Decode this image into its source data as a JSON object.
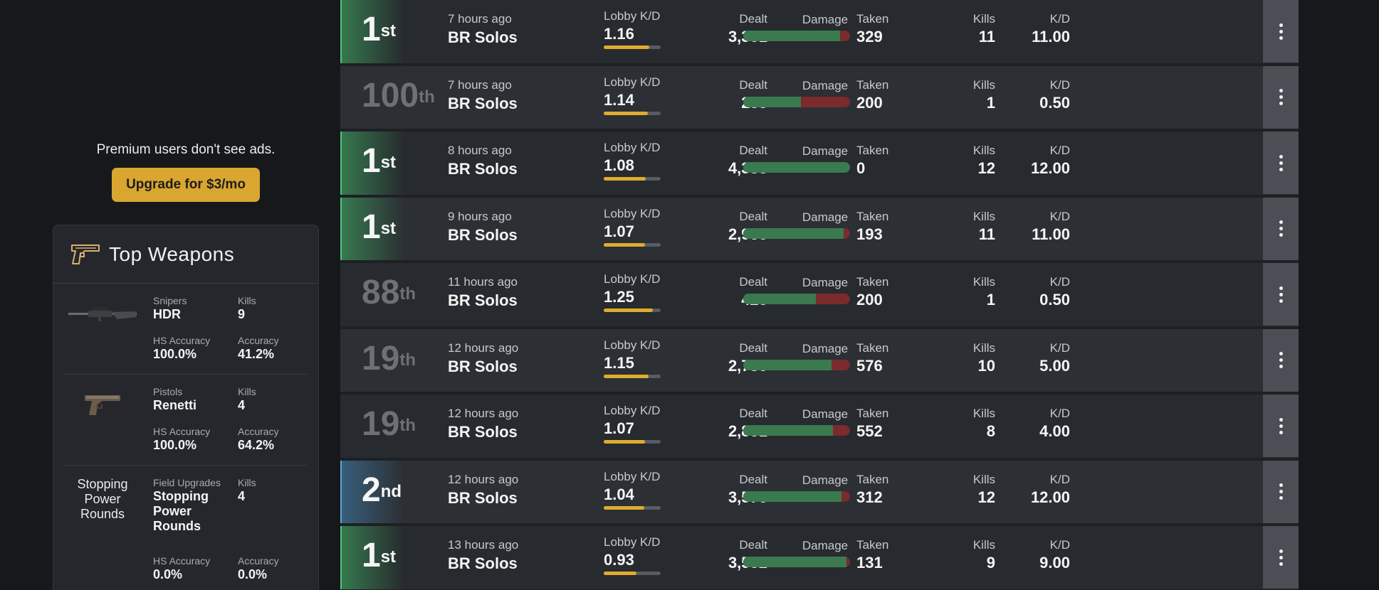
{
  "promo": {
    "text": "Premium users don't see ads.",
    "button_label": "Upgrade for $3/mo"
  },
  "weapons": {
    "title": "Top Weapons",
    "items": [
      {
        "category": "Snipers",
        "name": "HDR",
        "kills_label": "Kills",
        "kills": "9",
        "hs_label": "HS Accuracy",
        "hs": "100.0%",
        "acc_label": "Accuracy",
        "acc": "41.2%",
        "image": "sniper-rifle"
      },
      {
        "category": "Pistols",
        "name": "Renetti",
        "kills_label": "Kills",
        "kills": "4",
        "hs_label": "HS Accuracy",
        "hs": "100.0%",
        "acc_label": "Accuracy",
        "acc": "64.2%",
        "image": "pistol"
      },
      {
        "category": "Field Upgrades",
        "name": "Stopping Power Rounds",
        "image_text": "Stopping Power Rounds",
        "kills_label": "Kills",
        "kills": "4",
        "hs_label": "HS Accuracy",
        "hs": "0.0%",
        "acc_label": "Accuracy",
        "acc": "0.0%"
      }
    ]
  },
  "labels": {
    "lobby": "Lobby K/D",
    "dealt": "Dealt",
    "damage": "Damage",
    "taken": "Taken",
    "kills": "Kills",
    "kd": "K/D"
  },
  "colors": {
    "win_accent": "#52c37a",
    "second_accent": "#5fa7d8",
    "lobby_bar": "#e0ac2e",
    "damage_dealt": "#3a7a4e",
    "damage_taken": "#7b2a2d",
    "promo_button": "#d9a630"
  },
  "matches": [
    {
      "place": "1",
      "suffix": "st",
      "status": "win",
      "time": "7 hours ago",
      "mode": "BR Solos",
      "lobby_kd": "1.16",
      "lobby_pct": 0.8,
      "dealt": "3,301",
      "taken": "329",
      "kills": "11",
      "kd": "11.00",
      "dealt_share": 0.909
    },
    {
      "place": "100",
      "suffix": "th",
      "status": "lose",
      "time": "7 hours ago",
      "mode": "BR Solos",
      "lobby_kd": "1.14",
      "lobby_pct": 0.78,
      "dealt": "233",
      "taken": "200",
      "kills": "1",
      "kd": "0.50",
      "dealt_share": 0.538
    },
    {
      "place": "1",
      "suffix": "st",
      "status": "win",
      "time": "8 hours ago",
      "mode": "BR Solos",
      "lobby_kd": "1.08",
      "lobby_pct": 0.74,
      "dealt": "4,358",
      "taken": "0",
      "kills": "12",
      "kd": "12.00",
      "dealt_share": 1.0
    },
    {
      "place": "1",
      "suffix": "st",
      "status": "win",
      "time": "9 hours ago",
      "mode": "BR Solos",
      "lobby_kd": "1.07",
      "lobby_pct": 0.73,
      "dealt": "2,958",
      "taken": "193",
      "kills": "11",
      "kd": "11.00",
      "dealt_share": 0.939
    },
    {
      "place": "88",
      "suffix": "th",
      "status": "lose",
      "time": "11 hours ago",
      "mode": "BR Solos",
      "lobby_kd": "1.25",
      "lobby_pct": 0.86,
      "dealt": "428",
      "taken": "200",
      "kills": "1",
      "kd": "0.50",
      "dealt_share": 0.682
    },
    {
      "place": "19",
      "suffix": "th",
      "status": "lose",
      "time": "12 hours ago",
      "mode": "BR Solos",
      "lobby_kd": "1.15",
      "lobby_pct": 0.79,
      "dealt": "2,750",
      "taken": "576",
      "kills": "10",
      "kd": "5.00",
      "dealt_share": 0.827
    },
    {
      "place": "19",
      "suffix": "th",
      "status": "lose",
      "time": "12 hours ago",
      "mode": "BR Solos",
      "lobby_kd": "1.07",
      "lobby_pct": 0.73,
      "dealt": "2,831",
      "taken": "552",
      "kills": "8",
      "kd": "4.00",
      "dealt_share": 0.837
    },
    {
      "place": "2",
      "suffix": "nd",
      "status": "second",
      "time": "12 hours ago",
      "mode": "BR Solos",
      "lobby_kd": "1.04",
      "lobby_pct": 0.71,
      "dealt": "3,578",
      "taken": "312",
      "kills": "12",
      "kd": "12.00",
      "dealt_share": 0.92
    },
    {
      "place": "1",
      "suffix": "st",
      "status": "win",
      "time": "13 hours ago",
      "mode": "BR Solos",
      "lobby_kd": "0.93",
      "lobby_pct": 0.57,
      "dealt": "3,552",
      "taken": "131",
      "kills": "9",
      "kd": "9.00",
      "dealt_share": 0.964
    }
  ]
}
